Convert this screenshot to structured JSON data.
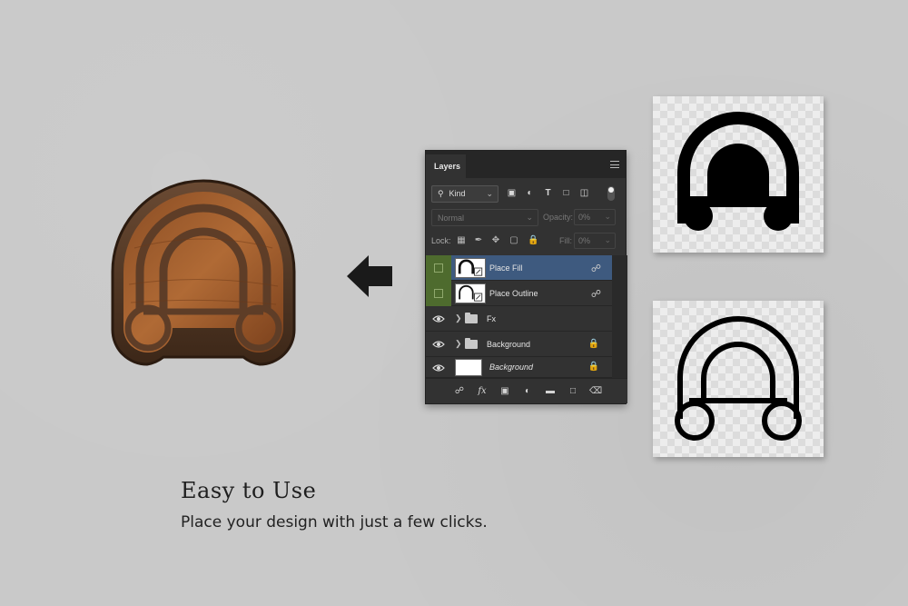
{
  "layers_panel": {
    "tab_label": "Layers",
    "filter": {
      "kind_label": "Kind"
    },
    "blend_mode": "Normal",
    "opacity_label": "Opacity:",
    "opacity_value": "0%",
    "lock_label": "Lock:",
    "fill_label": "Fill:",
    "fill_value": "0%",
    "layers": [
      {
        "name": "Place Fill",
        "selected": true,
        "type": "smart-object"
      },
      {
        "name": "Place Outline",
        "selected": false,
        "type": "smart-object"
      },
      {
        "name": "Fx",
        "selected": false,
        "type": "group"
      },
      {
        "name": "Background",
        "selected": false,
        "type": "group"
      },
      {
        "name": "Background",
        "selected": false,
        "type": "background"
      }
    ]
  },
  "caption": {
    "title": "Easy to Use",
    "subtitle": "Place your design with just a few clicks."
  },
  "colors": {
    "page_background": "#c9c9c9",
    "panel_background": "#323232",
    "selected_layer": "#3e5a7f",
    "visibility_green": "#4e6b2e",
    "wood": "#9a5a2c"
  }
}
